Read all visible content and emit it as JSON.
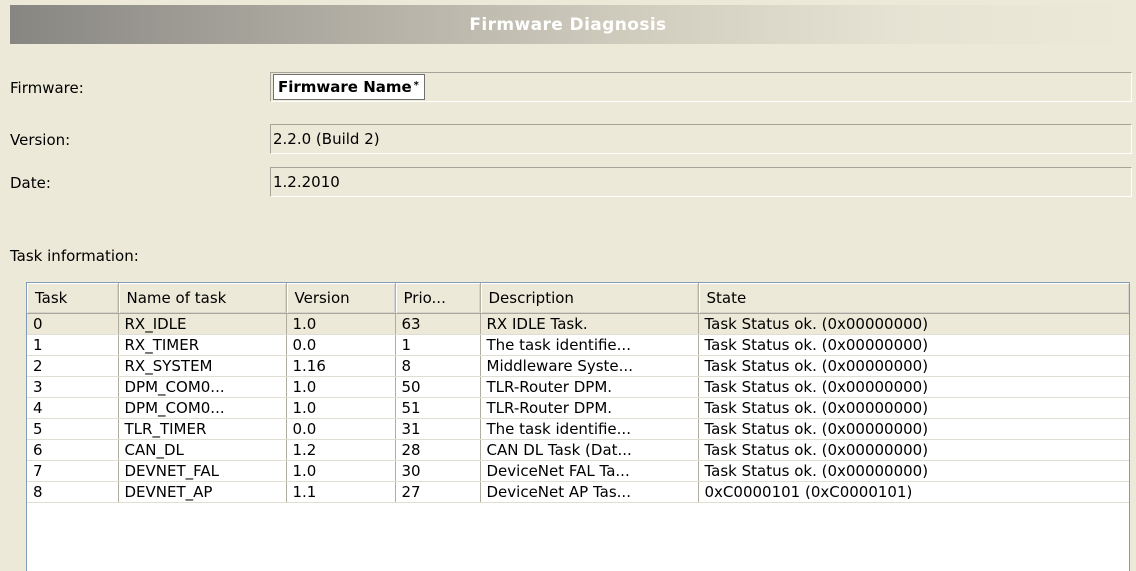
{
  "header": {
    "title": "Firmware Diagnosis"
  },
  "firmware": {
    "firmware_label": "Firmware:",
    "firmware_value": "Firmware Name",
    "firmware_marker": "*",
    "version_label": "Version:",
    "version_value": "2.2.0 (Build 2)",
    "date_label": "Date:",
    "date_value": "1.2.2010"
  },
  "tasks": {
    "section_label": "Task information:",
    "columns": [
      "Task",
      "Name of task",
      "Version",
      "Prio...",
      "Description",
      "State"
    ],
    "rows": [
      [
        "0",
        "RX_IDLE",
        "1.0",
        "63",
        "RX IDLE Task.",
        "Task Status ok. (0x00000000)"
      ],
      [
        "1",
        "RX_TIMER",
        "0.0",
        "1",
        "The task identifie...",
        "Task Status ok. (0x00000000)"
      ],
      [
        "2",
        "RX_SYSTEM",
        "1.16",
        "8",
        "Middleware Syste...",
        "Task Status ok. (0x00000000)"
      ],
      [
        "3",
        "DPM_COM0...",
        "1.0",
        "50",
        "TLR-Router DPM.",
        "Task Status ok. (0x00000000)"
      ],
      [
        "4",
        "DPM_COM0...",
        "1.0",
        "51",
        "TLR-Router DPM.",
        "Task Status ok. (0x00000000)"
      ],
      [
        "5",
        "TLR_TIMER",
        "0.0",
        "31",
        "The task identifie...",
        "Task Status ok. (0x00000000)"
      ],
      [
        "6",
        "CAN_DL",
        "1.2",
        "28",
        "CAN DL Task (Dat...",
        "Task Status ok. (0x00000000)"
      ],
      [
        "7",
        "DEVNET_FAL",
        "1.0",
        "30",
        "DeviceNet FAL Ta...",
        "Task Status ok. (0x00000000)"
      ],
      [
        "8",
        "DEVNET_AP",
        "1.1",
        "27",
        "DeviceNet AP Tas...",
        "0xC0000101 (0xC0000101)"
      ]
    ],
    "selected_row": 0
  },
  "colors": {
    "background": "#ece9d8",
    "title_text": "#ffffff",
    "selected_row": "#ece9d8"
  }
}
